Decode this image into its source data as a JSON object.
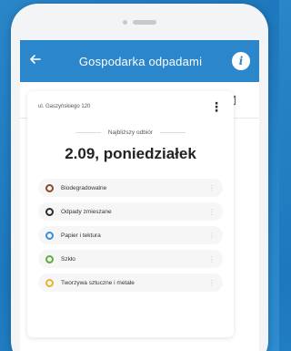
{
  "app": {
    "title": "Gospodarka odpadami"
  },
  "header": {
    "back_icon": "arrow-left-icon",
    "info_icon": "info-icon"
  },
  "tabs": [
    {
      "icon": "calendar-icon",
      "active": true
    },
    {
      "icon": "map-icon",
      "active": false
    },
    {
      "icon": "message-icon",
      "active": false
    },
    {
      "icon": "search-icon",
      "active": false
    },
    {
      "icon": "mail-icon",
      "active": false
    }
  ],
  "card": {
    "address": "ul. Gaszyńskiego 120",
    "next_label": "Najbliższy odbiór",
    "date": "2.09, poniedziałek"
  },
  "waste": [
    {
      "label": "Biodegradowalne",
      "color": "#8a4a2a"
    },
    {
      "label": "Odpady zmieszane",
      "color": "#2b2b2b"
    },
    {
      "label": "Papier i tektura",
      "color": "#3a8fd6"
    },
    {
      "label": "Szkło",
      "color": "#5fae3a"
    },
    {
      "label": "Tworzywa sztuczne i metale",
      "color": "#e8b22a"
    }
  ],
  "colors": {
    "accent": "#2c86cc",
    "background": "#1e78bd"
  }
}
